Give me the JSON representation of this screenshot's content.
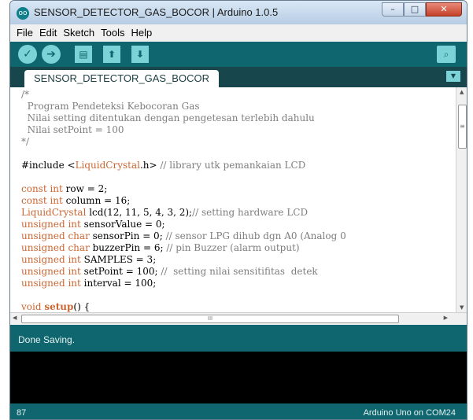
{
  "window": {
    "title": "SENSOR_DETECTOR_GAS_BOCOR | Arduino 1.0.5",
    "app_icon": "oo",
    "controls": {
      "minimize": "–",
      "maximize": "□",
      "close": "✕"
    }
  },
  "menu": [
    "File",
    "Edit",
    "Sketch",
    "Tools",
    "Help"
  ],
  "toolbar": {
    "verify_icon": "✓",
    "upload_icon": "➔",
    "new_icon": "▤",
    "open_icon": "⬆",
    "save_icon": "⬇",
    "serial_monitor_icon": "⌕"
  },
  "tab": {
    "label": "SENSOR_DETECTOR_GAS_BOCOR",
    "menu_icon": "▼"
  },
  "code": {
    "l1": "/*",
    "l2": "  Program Pendeteksi Kebocoran Gas",
    "l3": "  Nilai setting ditentukan dengan pengetesan terlebih dahulu",
    "l4": "  Nilai setPoint = 100",
    "l5": "*/",
    "l7a": "#include <",
    "l7b": "LiquidCrystal",
    "l7c": ".h> ",
    "l7d": "// library utk pemankaian LCD",
    "l9a": "const int",
    "l9b": " row = 2;",
    "l10a": "const int",
    "l10b": " column = 16;",
    "l11a": "LiquidCrystal",
    "l11b": " lcd(12, 11, 5, 4, 3, 2);",
    "l11c": "// setting hardware LCD",
    "l12a": "unsigned int",
    "l12b": " sensorValue = 0;",
    "l13a": "unsigned char",
    "l13b": " sensorPin = 0; ",
    "l13c": "// sensor LPG dihub dgn A0 (Analog 0",
    "l14a": "unsigned char",
    "l14b": " buzzerPin = 6; ",
    "l14c": "// pin Buzzer (alarm output)",
    "l15a": "unsigned int",
    "l15b": " SAMPLES = 3;",
    "l16a": "unsigned int",
    "l16b": " setPoint = 100; ",
    "l16c": "//  setting nilai sensitifitas  detek",
    "l17a": "unsigned int",
    "l17b": " interval = 100;",
    "l19a": "void",
    "l19b": " ",
    "l19c": "setup",
    "l19d": "() {"
  },
  "status": {
    "message": "Done Saving."
  },
  "footer": {
    "line": "87",
    "board": "Arduino Uno on COM24"
  }
}
